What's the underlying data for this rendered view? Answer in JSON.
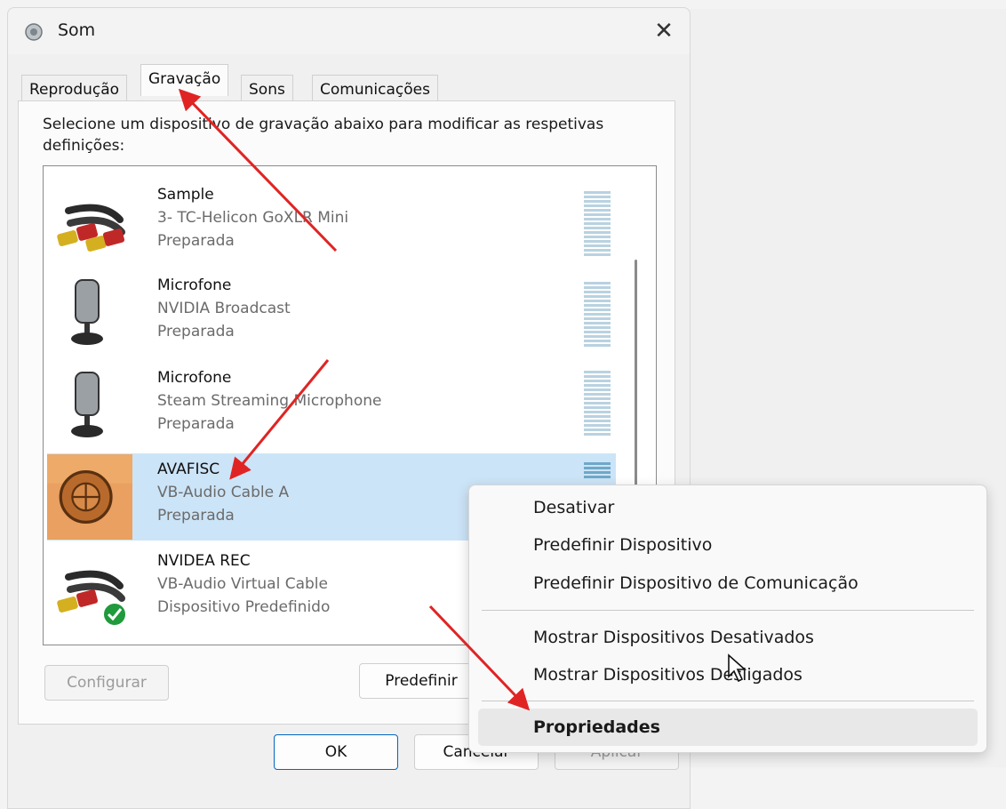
{
  "window": {
    "title": "Som"
  },
  "tabs": [
    "Reprodução",
    "Gravação",
    "Sons",
    "Comunicações"
  ],
  "active_tab": "Gravação",
  "instructions": "Selecione um dispositivo de gravação abaixo para modificar as respetivas definições:",
  "devices": [
    {
      "name": "Sample",
      "description": "3- TC-Helicon GoXLR Mini",
      "status": "Preparada",
      "icon": "rca-cable-icon"
    },
    {
      "name": "Microfone",
      "description": "NVIDIA Broadcast",
      "status": "Preparada",
      "icon": "microphone-icon"
    },
    {
      "name": "Microfone",
      "description": "Steam Streaming Microphone",
      "status": "Preparada",
      "icon": "microphone-icon"
    },
    {
      "name": "AVAFISC",
      "description": "VB-Audio Cable A",
      "status": "Preparada",
      "icon": "custom-device-image",
      "selected": true
    },
    {
      "name": "NVIDEA REC",
      "description": "VB-Audio Virtual Cable",
      "status": "Dispositivo Predefinido",
      "icon": "rca-cable-default-icon"
    }
  ],
  "buttons": {
    "configure": "Configurar",
    "set_default": "Predefinir",
    "ok": "OK",
    "cancel": "Cancelar",
    "apply": "Aplicar"
  },
  "context_menu": {
    "items": [
      "Desativar",
      "Predefinir Dispositivo",
      "Predefinir Dispositivo de Comunicação",
      "Mostrar Dispositivos Desativados",
      "Mostrar Dispositivos Desligados",
      "Propriedades"
    ],
    "highlighted": "Propriedades"
  },
  "colors": {
    "annotation_arrow": "#e02424",
    "selection": "#cce4f7",
    "accent": "#0067c0"
  }
}
